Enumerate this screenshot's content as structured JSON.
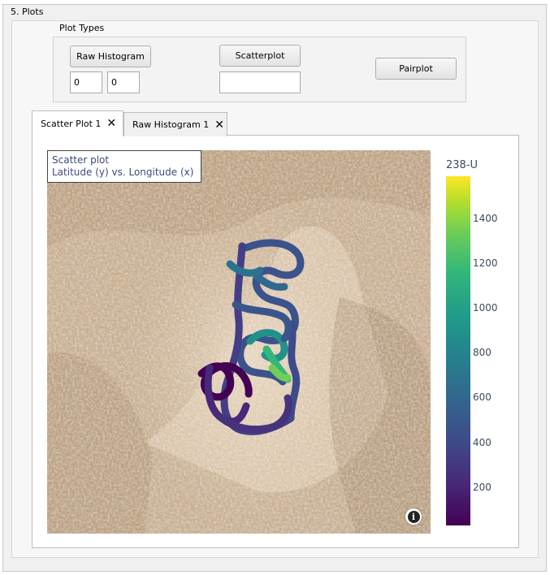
{
  "section": {
    "title": "5. Plots"
  },
  "plot_types": {
    "title": "Plot Types",
    "raw_histogram_label": "Raw Histogram",
    "scatterplot_label": "Scatterplot",
    "pairplot_label": "Pairplot",
    "histogram_field_1": "0",
    "histogram_field_2": "0",
    "scatter_field": ""
  },
  "tabs": [
    {
      "label": "Scatter Plot 1",
      "active": true
    },
    {
      "label": "Raw Histogram 1",
      "active": false
    }
  ],
  "plot": {
    "tooltip_line1": "Scatter plot",
    "tooltip_line2": "Latitude (y) vs. Longitude (x)",
    "colorbar_title": "238-U",
    "colorbar_ticks": [
      "1400",
      "1200",
      "1000",
      "800",
      "600",
      "400",
      "200"
    ],
    "colorscale": "viridis",
    "info_icon": "info-icon"
  }
}
